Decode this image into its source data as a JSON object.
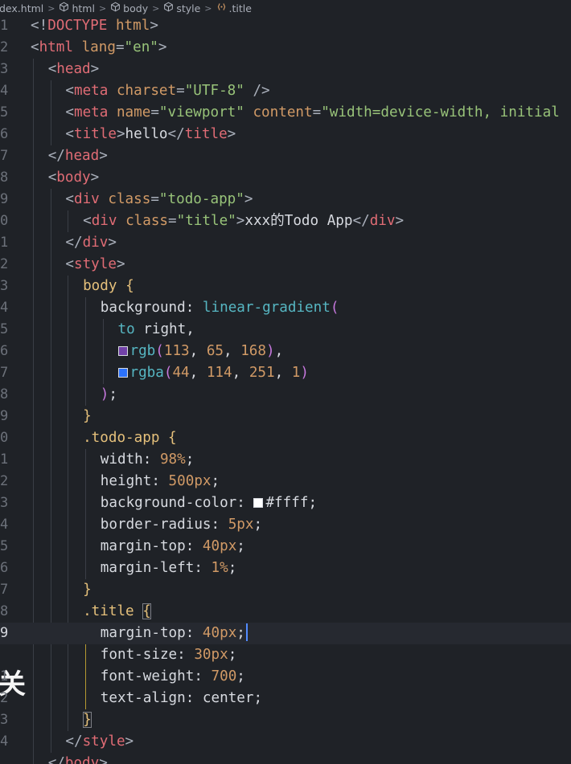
{
  "breadcrumb": {
    "items": [
      {
        "label": "dex.html",
        "icon": "html-file-icon"
      },
      {
        "label": "html",
        "icon": "cube-icon"
      },
      {
        "label": "body",
        "icon": "cube-icon"
      },
      {
        "label": "style",
        "icon": "cube-icon"
      },
      {
        "label": ".title",
        "icon": "css-selector-icon"
      }
    ],
    "separator": ">"
  },
  "editor": {
    "gutter": [
      "1",
      "2",
      "3",
      "4",
      "5",
      "6",
      "7",
      "8",
      "9",
      "0",
      "1",
      "2",
      "3",
      "4",
      "5",
      "6",
      "7",
      "8",
      "9",
      "0",
      "1",
      "2",
      "3",
      "4",
      "5",
      "6",
      "7",
      "8",
      "9",
      "",
      "1",
      "2",
      "3",
      "4"
    ],
    "current_line_index": 28,
    "overlay_glyph": "关",
    "swatches": {
      "purple": "#7141a8",
      "blue": "#2c72fb",
      "white": "#ffffff"
    },
    "lines": [
      {
        "tokens": [
          [
            "t-punc",
            "<!"
          ],
          [
            "t-tag",
            "DOCTYPE"
          ],
          [
            "t-text",
            " "
          ],
          [
            "t-attr",
            "html"
          ],
          [
            "t-punc",
            ">"
          ]
        ]
      },
      {
        "tokens": [
          [
            "t-punc",
            "<"
          ],
          [
            "t-tag",
            "html"
          ],
          [
            "t-text",
            " "
          ],
          [
            "t-attr",
            "lang"
          ],
          [
            "t-punc",
            "="
          ],
          [
            "t-str",
            "\"en\""
          ],
          [
            "t-punc",
            ">"
          ]
        ]
      },
      {
        "indent": 1,
        "tokens": [
          [
            "t-punc",
            "<"
          ],
          [
            "t-tag",
            "head"
          ],
          [
            "t-punc",
            ">"
          ]
        ]
      },
      {
        "indent": 2,
        "tokens": [
          [
            "t-punc",
            "<"
          ],
          [
            "t-tag",
            "meta"
          ],
          [
            "t-text",
            " "
          ],
          [
            "t-attr",
            "charset"
          ],
          [
            "t-punc",
            "="
          ],
          [
            "t-str",
            "\"UTF-8\""
          ],
          [
            "t-text",
            " "
          ],
          [
            "t-punc",
            "/>"
          ]
        ]
      },
      {
        "indent": 2,
        "tokens": [
          [
            "t-punc",
            "<"
          ],
          [
            "t-tag",
            "meta"
          ],
          [
            "t-text",
            " "
          ],
          [
            "t-attr",
            "name"
          ],
          [
            "t-punc",
            "="
          ],
          [
            "t-str",
            "\"viewport\""
          ],
          [
            "t-text",
            " "
          ],
          [
            "t-attr",
            "content"
          ],
          [
            "t-punc",
            "="
          ],
          [
            "t-str",
            "\"width=device-width, initial"
          ]
        ]
      },
      {
        "indent": 2,
        "tokens": [
          [
            "t-punc",
            "<"
          ],
          [
            "t-tag",
            "title"
          ],
          [
            "t-punc",
            ">"
          ],
          [
            "t-text",
            "hello"
          ],
          [
            "t-punc",
            "</"
          ],
          [
            "t-tag",
            "title"
          ],
          [
            "t-punc",
            ">"
          ]
        ]
      },
      {
        "indent": 1,
        "tokens": [
          [
            "t-punc",
            "</"
          ],
          [
            "t-tag",
            "head"
          ],
          [
            "t-punc",
            ">"
          ]
        ]
      },
      {
        "indent": 1,
        "tokens": [
          [
            "t-punc",
            "<"
          ],
          [
            "t-tag",
            "body"
          ],
          [
            "t-punc",
            ">"
          ]
        ]
      },
      {
        "indent": 2,
        "tokens": [
          [
            "t-punc",
            "<"
          ],
          [
            "t-tag",
            "div"
          ],
          [
            "t-text",
            " "
          ],
          [
            "t-attr",
            "class"
          ],
          [
            "t-punc",
            "="
          ],
          [
            "t-str",
            "\"todo-app\""
          ],
          [
            "t-punc",
            ">"
          ]
        ]
      },
      {
        "indent": 3,
        "tokens": [
          [
            "t-punc",
            "<"
          ],
          [
            "t-tag",
            "div"
          ],
          [
            "t-text",
            " "
          ],
          [
            "t-attr",
            "class"
          ],
          [
            "t-punc",
            "="
          ],
          [
            "t-str",
            "\"title\""
          ],
          [
            "t-punc",
            ">"
          ],
          [
            "t-text",
            "xxx的Todo App"
          ],
          [
            "t-punc",
            "</"
          ],
          [
            "t-tag",
            "div"
          ],
          [
            "t-punc",
            ">"
          ]
        ]
      },
      {
        "indent": 2,
        "tokens": [
          [
            "t-punc",
            "</"
          ],
          [
            "t-tag",
            "div"
          ],
          [
            "t-punc",
            ">"
          ]
        ]
      },
      {
        "indent": 2,
        "tokens": [
          [
            "t-punc",
            "<"
          ],
          [
            "t-tag",
            "style"
          ],
          [
            "t-punc",
            ">"
          ]
        ]
      },
      {
        "indent": 3,
        "tokens": [
          [
            "t-sel",
            "body"
          ],
          [
            "t-text",
            " "
          ],
          [
            "t-brace",
            "{"
          ]
        ]
      },
      {
        "indent": 4,
        "tokens": [
          [
            "t-prop",
            "background"
          ],
          [
            "t-text",
            ": "
          ],
          [
            "t-func",
            "linear-gradient"
          ],
          [
            "t-paren",
            "("
          ]
        ]
      },
      {
        "indent": 5,
        "tokens": [
          [
            "t-kw",
            "to"
          ],
          [
            "t-text",
            " right,"
          ]
        ]
      },
      {
        "indent": 5,
        "swatch": "purple",
        "tokens": [
          [
            "t-func",
            "rgb"
          ],
          [
            "t-paren",
            "("
          ],
          [
            "t-num",
            "113"
          ],
          [
            "t-text",
            ", "
          ],
          [
            "t-num",
            "65"
          ],
          [
            "t-text",
            ", "
          ],
          [
            "t-num",
            "168"
          ],
          [
            "t-paren",
            ")"
          ],
          [
            "t-text",
            ","
          ]
        ]
      },
      {
        "indent": 5,
        "swatch": "blue",
        "tokens": [
          [
            "t-func",
            "rgba"
          ],
          [
            "t-paren",
            "("
          ],
          [
            "t-num",
            "44"
          ],
          [
            "t-text",
            ", "
          ],
          [
            "t-num",
            "114"
          ],
          [
            "t-text",
            ", "
          ],
          [
            "t-num",
            "251"
          ],
          [
            "t-text",
            ", "
          ],
          [
            "t-num",
            "1"
          ],
          [
            "t-paren",
            ")"
          ]
        ]
      },
      {
        "indent": 4,
        "tokens": [
          [
            "t-paren",
            ")"
          ],
          [
            "t-text",
            ";"
          ]
        ]
      },
      {
        "indent": 3,
        "tokens": [
          [
            "t-brace",
            "}"
          ]
        ]
      },
      {
        "indent": 3,
        "tokens": [
          [
            "t-sel",
            ".todo-app"
          ],
          [
            "t-text",
            " "
          ],
          [
            "t-brace",
            "{"
          ]
        ]
      },
      {
        "indent": 4,
        "tokens": [
          [
            "t-prop",
            "width"
          ],
          [
            "t-text",
            ": "
          ],
          [
            "t-num",
            "98%"
          ],
          [
            "t-text",
            ";"
          ]
        ]
      },
      {
        "indent": 4,
        "tokens": [
          [
            "t-prop",
            "height"
          ],
          [
            "t-text",
            ": "
          ],
          [
            "t-num",
            "500px"
          ],
          [
            "t-text",
            ";"
          ]
        ]
      },
      {
        "indent": 4,
        "swatch": "white",
        "swatchAfter": "background-color: ",
        "tokens": [
          [
            "t-hex",
            "#ffff"
          ],
          [
            "t-text",
            ";"
          ]
        ]
      },
      {
        "indent": 4,
        "tokens": [
          [
            "t-prop",
            "border-radius"
          ],
          [
            "t-text",
            ": "
          ],
          [
            "t-num",
            "5px"
          ],
          [
            "t-text",
            ";"
          ]
        ]
      },
      {
        "indent": 4,
        "tokens": [
          [
            "t-prop",
            "margin-top"
          ],
          [
            "t-text",
            ": "
          ],
          [
            "t-num",
            "40px"
          ],
          [
            "t-text",
            ";"
          ]
        ]
      },
      {
        "indent": 4,
        "tokens": [
          [
            "t-prop",
            "margin-left"
          ],
          [
            "t-text",
            ": "
          ],
          [
            "t-num",
            "1%"
          ],
          [
            "t-text",
            ";"
          ]
        ]
      },
      {
        "indent": 3,
        "tokens": [
          [
            "t-brace",
            "}"
          ]
        ]
      },
      {
        "indent": 3,
        "tokens": [
          [
            "t-sel",
            ".title"
          ],
          [
            "t-text",
            " "
          ],
          [
            "t-brace",
            "{"
          ]
        ],
        "boxLast": true
      },
      {
        "indent": 4,
        "cursor": true,
        "tokens": [
          [
            "t-prop",
            "margin-top"
          ],
          [
            "t-text",
            ": "
          ],
          [
            "t-num",
            "40px"
          ],
          [
            "t-text",
            ";"
          ]
        ]
      },
      {
        "indent": 4,
        "tokens": [
          [
            "t-prop",
            "font-size"
          ],
          [
            "t-text",
            ": "
          ],
          [
            "t-num",
            "30px"
          ],
          [
            "t-text",
            ";"
          ]
        ]
      },
      {
        "indent": 4,
        "tokens": [
          [
            "t-prop",
            "font-weight"
          ],
          [
            "t-text",
            ": "
          ],
          [
            "t-num",
            "700"
          ],
          [
            "t-text",
            ";"
          ]
        ]
      },
      {
        "indent": 4,
        "tokens": [
          [
            "t-prop",
            "text-align"
          ],
          [
            "t-text",
            ": center;"
          ]
        ]
      },
      {
        "indent": 3,
        "tokens": [
          [
            "t-brace",
            "}"
          ]
        ],
        "boxLast": true
      },
      {
        "indent": 2,
        "tokens": [
          [
            "t-punc",
            "</"
          ],
          [
            "t-tag",
            "style"
          ],
          [
            "t-punc",
            ">"
          ]
        ]
      },
      {
        "indent": 1,
        "tokens": [
          [
            "t-punc",
            "</"
          ],
          [
            "t-tag",
            "body"
          ],
          [
            "t-punc",
            ">"
          ]
        ]
      }
    ]
  }
}
